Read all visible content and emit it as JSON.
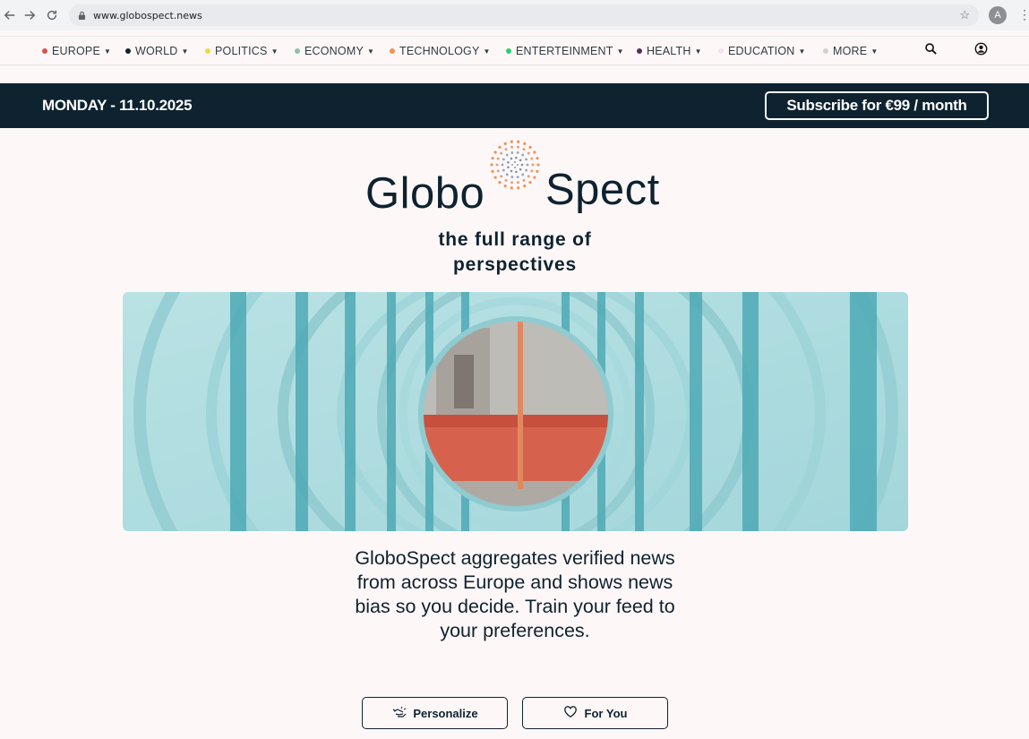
{
  "browser": {
    "url": "www.globospect.news",
    "profile_initial": "A"
  },
  "nav": {
    "categories": [
      {
        "label": "EUROPE",
        "color": "#d9534f"
      },
      {
        "label": "WORLD",
        "color": "#0e2230"
      },
      {
        "label": "POLITICS",
        "color": "#f5d547"
      },
      {
        "label": "ECONOMY",
        "color": "#8fc1a9"
      },
      {
        "label": "TECHNOLOGY",
        "color": "#f0915a"
      },
      {
        "label": "ENTERTEINMENT",
        "color": "#2ecc71"
      },
      {
        "label": "HEALTH",
        "color": "#5a2d5c"
      },
      {
        "label": "EDUCATION",
        "color": "#f5dff0"
      },
      {
        "label": "MORE",
        "color": "#cfcfcf"
      }
    ]
  },
  "datebar": {
    "date": "MONDAY - 11.10.2025",
    "subscribe_label": "Subscribe for €99 / month"
  },
  "brand": {
    "name_part1": "Globo",
    "name_part2": "Spect",
    "tagline": "the full range of perspectives"
  },
  "intro": {
    "text": "GloboSpect aggregates verified news from across Europe and shows news bias so you decide. Train your feed to your preferences."
  },
  "actions": {
    "personalize_label": "Personalize",
    "for_you_label": "For You"
  },
  "colors": {
    "navy": "#0e2230",
    "background": "#fdf8f7",
    "hero_teal": "#8ed3d8"
  }
}
